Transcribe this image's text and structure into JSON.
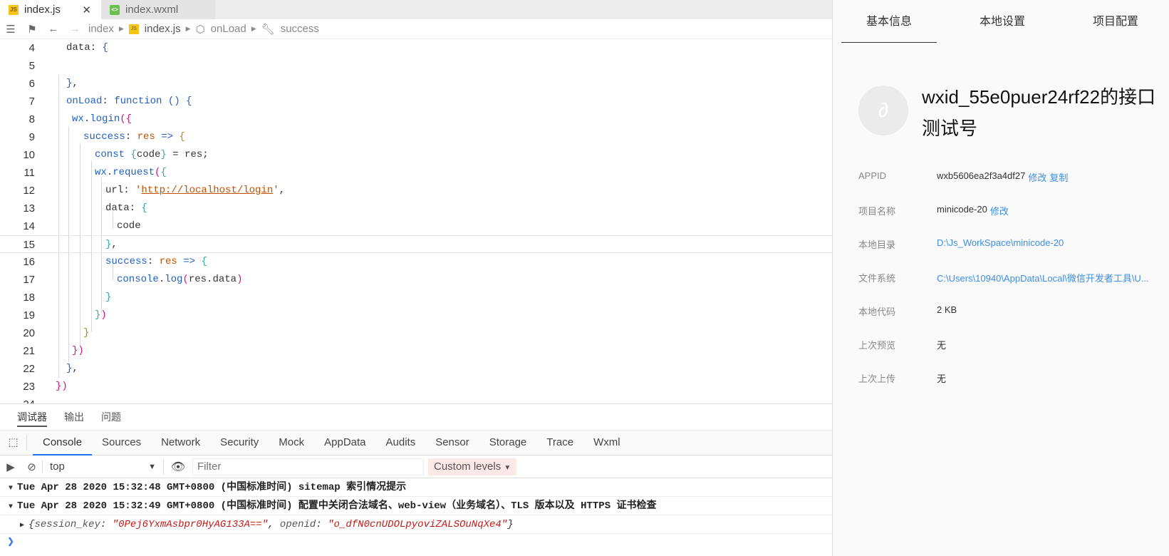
{
  "tabs": [
    {
      "label": "index.js",
      "icon": "js-file-icon",
      "active": true
    },
    {
      "label": "index.wxml",
      "icon": "wxml-file-icon",
      "active": false
    }
  ],
  "breadcrumb": {
    "items": [
      "index",
      "index.js",
      "onLoad",
      "success"
    ]
  },
  "code": {
    "line_numbers": [
      "4",
      "5",
      "6",
      "7",
      "8",
      "9",
      "10",
      "11",
      "12",
      "13",
      "14",
      "15",
      "16",
      "17",
      "18",
      "19",
      "20",
      "21",
      "22",
      "23",
      "24"
    ]
  },
  "bottom_tabs": [
    "调试器",
    "输出",
    "问题"
  ],
  "devtools_tabs": [
    "Console",
    "Sources",
    "Network",
    "Security",
    "Mock",
    "AppData",
    "Audits",
    "Sensor",
    "Storage",
    "Trace",
    "Wxml"
  ],
  "console": {
    "context": "top",
    "filter_placeholder": "Filter",
    "levels": "Custom levels",
    "logs": [
      {
        "text": "Tue Apr 28 2020 15:32:48 GMT+0800 (中国标准时间) sitemap 索引情况提示"
      },
      {
        "text": "Tue Apr 28 2020 15:32:49 GMT+0800 (中国标准时间) 配置中关闭合法域名、web-view（业务域名）、TLS 版本以及 HTTPS 证书检查"
      }
    ],
    "object": {
      "key1": "session_key",
      "val1": "\"0Pej6YxmAsbpr0HyAG133A==\"",
      "key2": "openid",
      "val2": "\"o_dfN0cnUDOLpyoviZALSOuNqXe4\""
    }
  },
  "panel": {
    "tabs": [
      "基本信息",
      "本地设置",
      "项目配置"
    ],
    "project_title": "wxid_55e0puer24rf22的接口测试号",
    "rows": [
      {
        "label": "APPID",
        "value": "wxb5606ea2f3a4df27",
        "links": [
          "修改",
          "复制"
        ]
      },
      {
        "label": "项目名称",
        "value": "minicode-20",
        "links": [
          "修改"
        ]
      },
      {
        "label": "本地目录",
        "value": "D:\\Js_WorkSpace\\minicode-20",
        "links": []
      },
      {
        "label": "文件系统",
        "value": "C:\\Users\\10940\\AppData\\Local\\微信开发者工具\\U...",
        "links": []
      },
      {
        "label": "本地代码",
        "value": "2 KB",
        "links": []
      },
      {
        "label": "上次预览",
        "value": "无",
        "links": []
      },
      {
        "label": "上次上传",
        "value": "无",
        "links": []
      }
    ]
  },
  "colors": {
    "link": "#3a8ee6",
    "active_tab": "#1a73e8",
    "levels_bg": "#fde8e8"
  }
}
